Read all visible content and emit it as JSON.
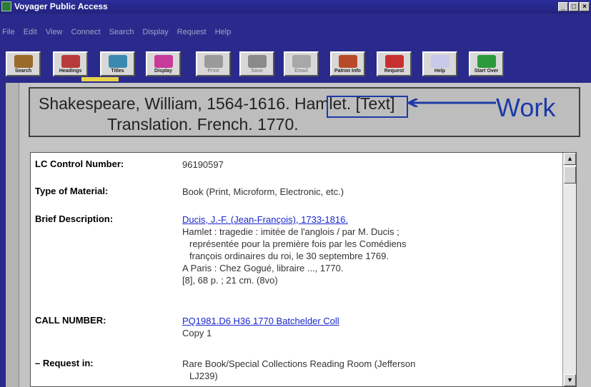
{
  "window": {
    "title": "Voyager Public Access",
    "buttons": [
      "_",
      "□",
      "×"
    ]
  },
  "menu": [
    "File",
    "Edit",
    "View",
    "Connect",
    "Search",
    "Display",
    "Request",
    "Help"
  ],
  "toolbar": [
    {
      "label": "Search",
      "icon": "binoculars-icon",
      "color": "#9a6a28"
    },
    {
      "label": "Headings",
      "icon": "books-icon",
      "color": "#b83a3a"
    },
    {
      "label": "Titles",
      "icon": "book-icon",
      "color": "#3a8ab0"
    },
    {
      "label": "Display",
      "icon": "display-icon",
      "color": "#c83a9a"
    },
    {
      "label": "Print",
      "icon": "printer-icon",
      "color": "#9a9a9a"
    },
    {
      "label": "Save",
      "icon": "disk-icon",
      "color": "#8a8a8a"
    },
    {
      "label": "Email",
      "icon": "email-icon",
      "color": "#a8a8a8"
    },
    {
      "label": "Patron Info",
      "icon": "patron-icon",
      "color": "#b84a2a"
    },
    {
      "label": "Request",
      "icon": "request-icon",
      "color": "#c83030"
    },
    {
      "label": "Help",
      "icon": "help-icon",
      "color": "#c8c8e8"
    },
    {
      "label": "Start Over",
      "icon": "start-over-icon",
      "color": "#2a9a3a"
    }
  ],
  "callout": {
    "line1": "Shakespeare, William, 1564-1616.  Hamlet. [Text]",
    "line2": "Translation.  French.  1770.",
    "annotation": "Work"
  },
  "record": {
    "rows": [
      {
        "label": "LC Control Number:",
        "value": "96190597"
      },
      {
        "label": "Type of Material:",
        "value": "Book (Print, Microform, Electronic, etc.)"
      },
      {
        "label": "Brief Description:",
        "link": "Ducis, J.-F. (Jean-François), 1733-1816.",
        "lines": [
          "Hamlet : tragedie : imitée de l'anglois / par M. Ducis ;",
          "représentée pour la première fois par les Comédiens",
          "françois ordinaires du roi, le 30 septembre 1769.",
          "A Paris : Chez Gogué, libraire ..., 1770.",
          "[8], 68 p. ; 21 cm. (8vo)"
        ]
      },
      {
        "label": "CALL NUMBER:",
        "link": "PQ1981.D6 H36 1770 Batchelder Coll",
        "extra": "Copy 1"
      },
      {
        "label": "– Request in:",
        "lines": [
          "Rare Book/Special Collections Reading Room (Jefferson",
          "LJ239)"
        ]
      }
    ]
  },
  "colors": {
    "accent": "#1d3aa8",
    "link": "#1a27cc",
    "background": "#2a2a8c"
  }
}
